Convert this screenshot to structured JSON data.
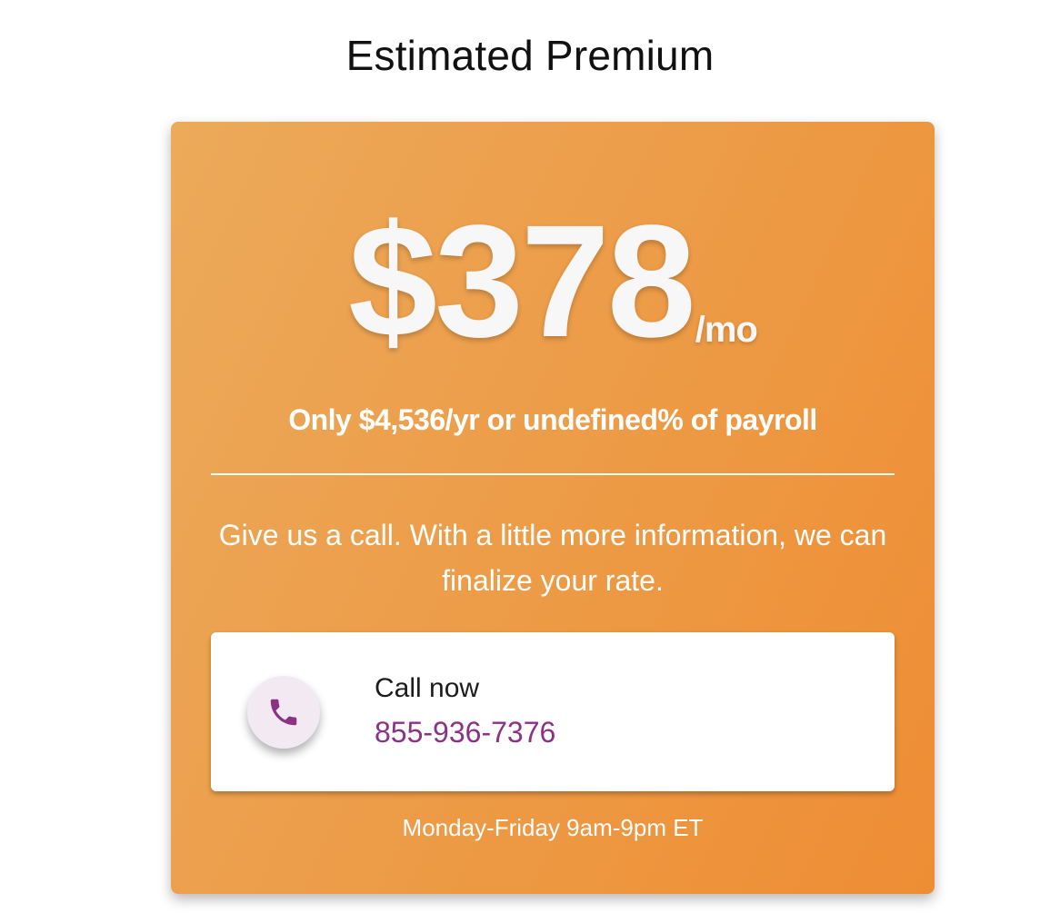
{
  "page": {
    "title": "Estimated Premium"
  },
  "premium": {
    "price": "$378",
    "period": "/mo",
    "summary": "Only $4,536/yr or undefined% of payroll"
  },
  "message": "Give us a call. With a little more information, we can finalize your rate.",
  "call": {
    "icon": "phone-icon",
    "label": "Call now",
    "number": "855-936-7376"
  },
  "hours": "Monday-Friday 9am-9pm ET",
  "colors": {
    "card_gradient_start": "#ecaa5a",
    "card_gradient_end": "#ee8d34",
    "phone_accent": "#8a3385",
    "icon_circle": "#f3e9f3"
  }
}
